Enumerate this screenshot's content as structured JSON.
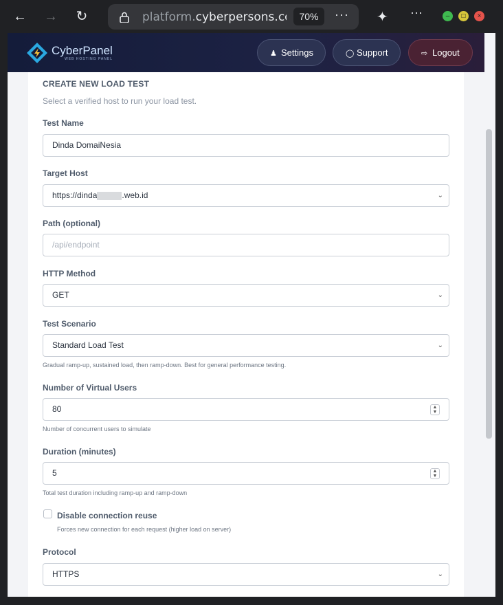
{
  "browser": {
    "url_prefix": "platform.",
    "url_domain": "cyberpersons.com",
    "url_suffix": "/",
    "zoom": "70%",
    "more": "···"
  },
  "header": {
    "brand": "CyberPanel",
    "brand_sub": "WEB HOSTING PANEL",
    "settings": "Settings",
    "support": "Support",
    "logout": "Logout"
  },
  "form": {
    "title": "CREATE NEW LOAD TEST",
    "subtitle": "Select a verified host to run your load test.",
    "test_name_label": "Test Name",
    "test_name_value": "Dinda DomaiNesia",
    "target_host_label": "Target Host",
    "target_host_prefix": "https://dinda",
    "target_host_suffix": ".web.id",
    "path_label": "Path (optional)",
    "path_placeholder": "/api/endpoint",
    "method_label": "HTTP Method",
    "method_value": "GET",
    "scenario_label": "Test Scenario",
    "scenario_value": "Standard Load Test",
    "scenario_help": "Gradual ramp-up, sustained load, then ramp-down. Best for general performance testing.",
    "users_label": "Number of Virtual Users",
    "users_value": "80",
    "users_help": "Number of concurrent users to simulate",
    "duration_label": "Duration (minutes)",
    "duration_value": "5",
    "duration_help": "Total test duration including ramp-up and ramp-down",
    "reuse_label": "Disable connection reuse",
    "reuse_help": "Forces new connection for each request (higher load on server)",
    "protocol_label": "Protocol",
    "protocol_value": "HTTPS"
  },
  "colors": {
    "accent": "#1d2244",
    "logout": "#4a2233"
  },
  "icons": [
    "back-arrow-icon",
    "forward-arrow-icon",
    "reload-icon",
    "lock-icon",
    "extensions-icon",
    "menu-dots-icon",
    "user-gear-icon",
    "support-icon",
    "logout-icon",
    "chevron-down-icon",
    "spinner-icon"
  ]
}
